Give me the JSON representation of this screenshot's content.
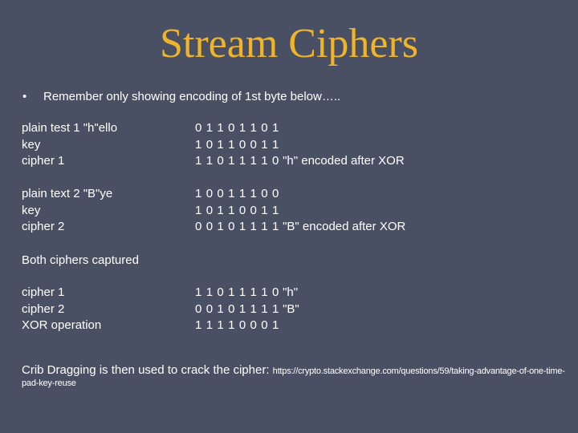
{
  "slide": {
    "title": "Stream Ciphers",
    "bullet": {
      "marker": "•",
      "text": "Remember only showing encoding of 1st byte below….."
    },
    "block1": [
      {
        "label": "plain test 1 \"h\"ello",
        "bits": "0 1 1 0 1 1 0 1",
        "note": ""
      },
      {
        "label": "key",
        "bits": "1 0 1 1 0 0 1 1",
        "note": ""
      },
      {
        "label": "cipher 1",
        "bits": "1 1 0 1 1 1 1 0",
        "note": " \"h\" encoded after XOR"
      }
    ],
    "block2": [
      {
        "label": "plain text 2 \"B\"ye",
        "bits": "1 0 0 1 1 1 0 0",
        "note": ""
      },
      {
        "label": "key",
        "bits": "1 0 1 1 0 0 1 1",
        "note": ""
      },
      {
        "label": "cipher 2",
        "bits": "0 0 1 0 1 1 1 1",
        "note": " \"B\" encoded after XOR"
      }
    ],
    "captured_heading": "Both ciphers captured",
    "block3": [
      {
        "label": "cipher 1",
        "bits": "1 1 0 1 1 1 1 0",
        "note": " \"h\""
      },
      {
        "label": "cipher 2",
        "bits": "0 0 1 0 1 1 1 1",
        "note": " \"B\""
      },
      {
        "label": "XOR operation",
        "bits": "1 1 1 1 0 0 0 1",
        "note": ""
      }
    ],
    "footer": {
      "text": "Crib Dragging is then used to crack the cipher: ",
      "link": "https://crypto.stackexchange.com/questions/59/taking-advantage-of-one-time-pad-key-reuse"
    }
  },
  "colors": {
    "background": "#4a5064",
    "title": "#f0b429",
    "text": "#ffffff"
  }
}
